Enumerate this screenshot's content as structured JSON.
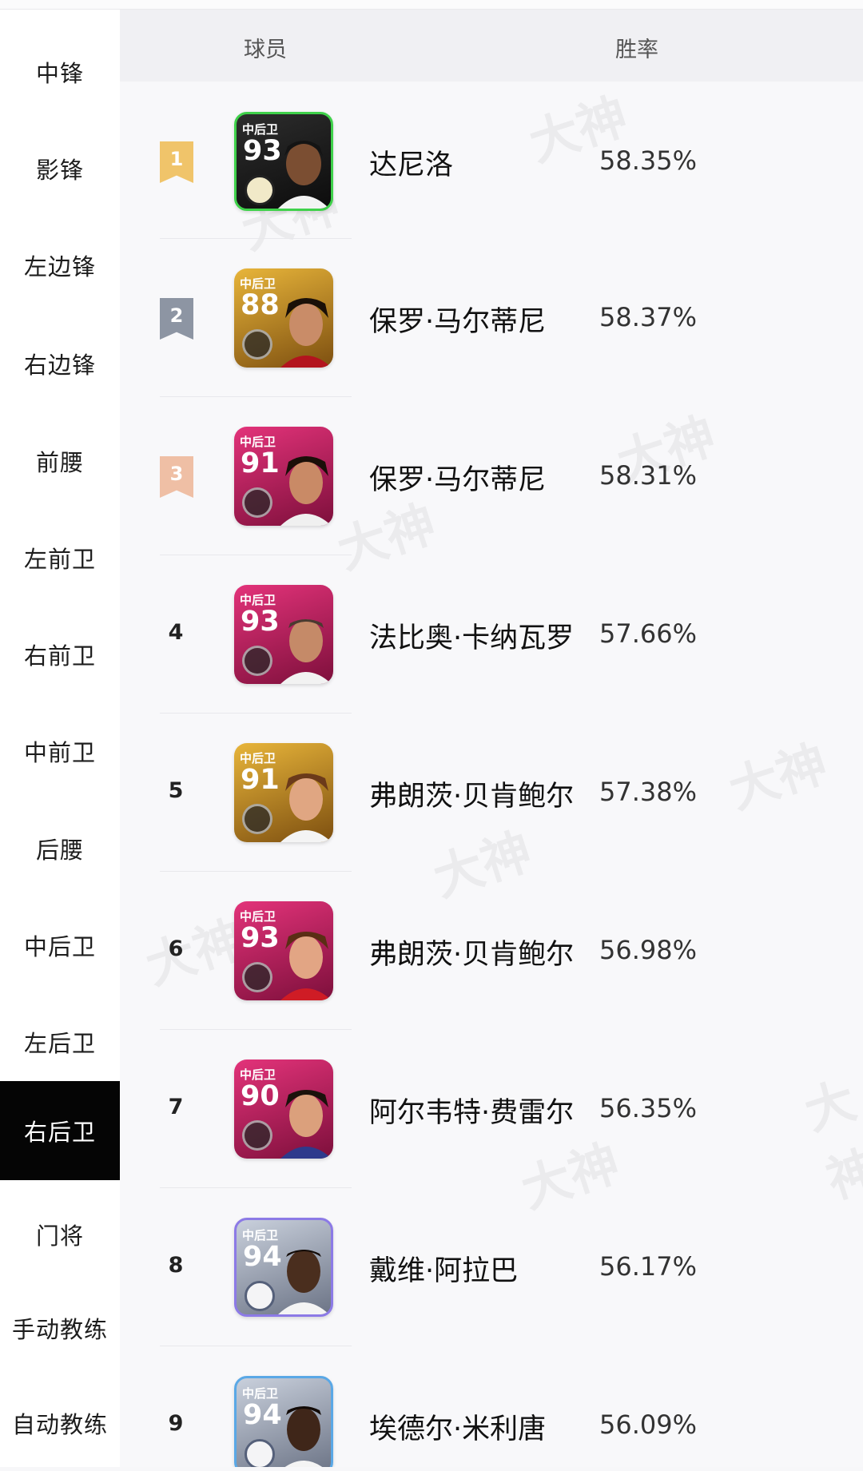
{
  "sidebar": {
    "items": [
      {
        "label": "中锋"
      },
      {
        "label": "影锋"
      },
      {
        "label": "左边锋"
      },
      {
        "label": "右边锋"
      },
      {
        "label": "前腰"
      },
      {
        "label": "左前卫"
      },
      {
        "label": "右前卫"
      },
      {
        "label": "中前卫"
      },
      {
        "label": "后腰"
      },
      {
        "label": "中后卫"
      },
      {
        "label": "左后卫"
      },
      {
        "label": "右后卫",
        "active": true
      },
      {
        "label": "门将"
      },
      {
        "label": "手动教练"
      },
      {
        "label": "自动教练"
      }
    ]
  },
  "table": {
    "headers": {
      "player": "球员",
      "winrate": "胜率"
    },
    "rows": [
      {
        "rank": "1",
        "position": "中后卫",
        "rating": "93",
        "name": "达尼洛",
        "winrate": "58.35%"
      },
      {
        "rank": "2",
        "position": "中后卫",
        "rating": "88",
        "name": "保罗·马尔蒂尼",
        "winrate": "58.37%"
      },
      {
        "rank": "3",
        "position": "中后卫",
        "rating": "91",
        "name": "保罗·马尔蒂尼",
        "winrate": "58.31%"
      },
      {
        "rank": "4",
        "position": "中后卫",
        "rating": "93",
        "name": "法比奥·卡纳瓦罗",
        "winrate": "57.66%"
      },
      {
        "rank": "5",
        "position": "中后卫",
        "rating": "91",
        "name": "弗朗茨·贝肯鲍尔",
        "winrate": "57.38%"
      },
      {
        "rank": "6",
        "position": "中后卫",
        "rating": "93",
        "name": "弗朗茨·贝肯鲍尔",
        "winrate": "56.98%"
      },
      {
        "rank": "7",
        "position": "中后卫",
        "rating": "90",
        "name": "阿尔韦特·费雷尔",
        "winrate": "56.35%"
      },
      {
        "rank": "8",
        "position": "中后卫",
        "rating": "94",
        "name": "戴维·阿拉巴",
        "winrate": "56.17%"
      },
      {
        "rank": "9",
        "position": "中后卫",
        "rating": "94",
        "name": "埃德尔·米利唐",
        "winrate": "56.09%"
      }
    ]
  },
  "colors": {
    "gold_badge": "#f0c46a",
    "silver_badge": "#8d95a3",
    "bronze_badge": "#efbfa5",
    "active_sidebar": "#050505"
  },
  "watermark": "大神"
}
